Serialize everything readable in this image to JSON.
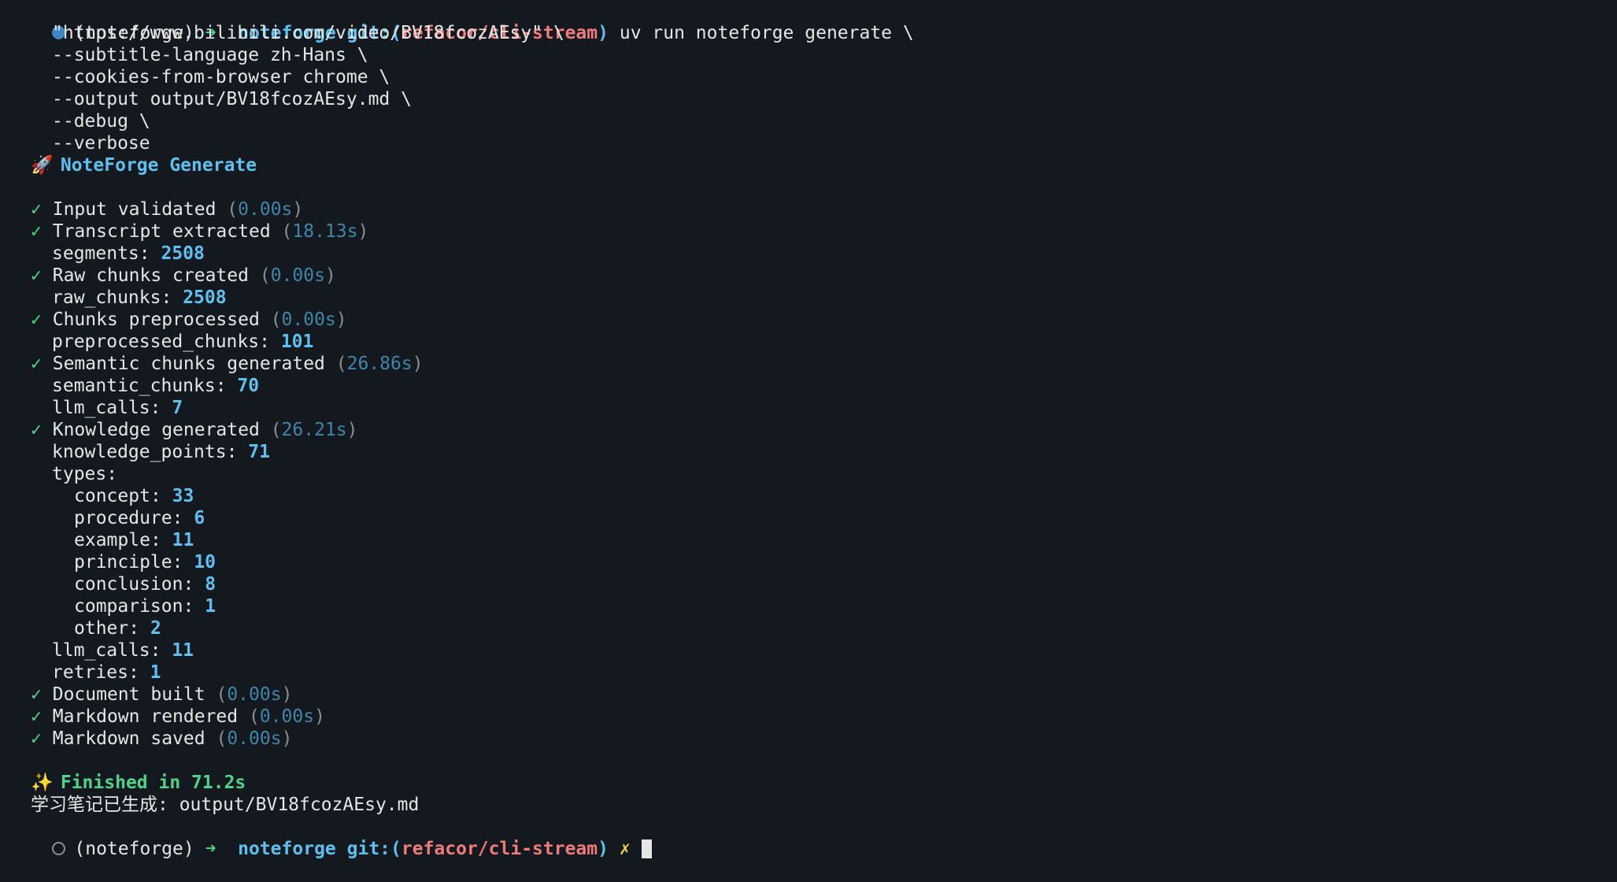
{
  "prompt": {
    "env": "(noteforge)",
    "arrow": "➜",
    "dir": "noteforge",
    "git_prefix": "git:(",
    "branch": "refacor/cli-stream",
    "git_suffix": ")",
    "dirty_mark": "✗"
  },
  "command": {
    "first": "uv run noteforge generate \\",
    "args": [
      "\"https://www.bilibili.com/video/BV18fcozAEsy\" \\",
      "--subtitle-language zh-Hans \\",
      "--cookies-from-browser chrome \\",
      "--output output/BV18fcozAEsy.md \\",
      "--debug \\",
      "--verbose"
    ]
  },
  "header": {
    "icon": "🚀",
    "title": "NoteForge Generate"
  },
  "steps": [
    {
      "label": "Input validated",
      "time": "0.00s",
      "details": []
    },
    {
      "label": "Transcript extracted",
      "time": "18.13s",
      "details": [
        {
          "key": "segments",
          "value": "2508"
        }
      ]
    },
    {
      "label": "Raw chunks created",
      "time": "0.00s",
      "details": [
        {
          "key": "raw_chunks",
          "value": "2508"
        }
      ]
    },
    {
      "label": "Chunks preprocessed",
      "time": "0.00s",
      "details": [
        {
          "key": "preprocessed_chunks",
          "value": "101"
        }
      ]
    },
    {
      "label": "Semantic chunks generated",
      "time": "26.86s",
      "details": [
        {
          "key": "semantic_chunks",
          "value": "70"
        },
        {
          "key": "llm_calls",
          "value": "7"
        }
      ]
    },
    {
      "label": "Knowledge generated",
      "time": "26.21s",
      "details": [
        {
          "key": "knowledge_points",
          "value": "71"
        }
      ]
    }
  ],
  "types_label": "types:",
  "types": [
    {
      "key": "concept",
      "value": "33"
    },
    {
      "key": "procedure",
      "value": "6"
    },
    {
      "key": "example",
      "value": "11"
    },
    {
      "key": "principle",
      "value": "10"
    },
    {
      "key": "conclusion",
      "value": "8"
    },
    {
      "key": "comparison",
      "value": "1"
    },
    {
      "key": "other",
      "value": "2"
    }
  ],
  "knowledge_extra": [
    {
      "key": "llm_calls",
      "value": "11"
    },
    {
      "key": "retries",
      "value": "1"
    }
  ],
  "final_steps": [
    {
      "label": "Document built",
      "time": "0.00s"
    },
    {
      "label": "Markdown rendered",
      "time": "0.00s"
    },
    {
      "label": "Markdown saved",
      "time": "0.00s"
    }
  ],
  "finished": {
    "icon": "✨",
    "text": "Finished in 71.2s"
  },
  "result_line": "学习笔记已生成: output/BV18fcozAEsy.md",
  "check_mark": "✓",
  "colors": {
    "background": "#14191f",
    "text": "#e6e6e6",
    "accent_blue": "#5ec0ef",
    "branch_red": "#f07b7b",
    "success_green": "#50d28a",
    "dirty_yellow": "#f0d054",
    "muted": "#8a8f96"
  }
}
